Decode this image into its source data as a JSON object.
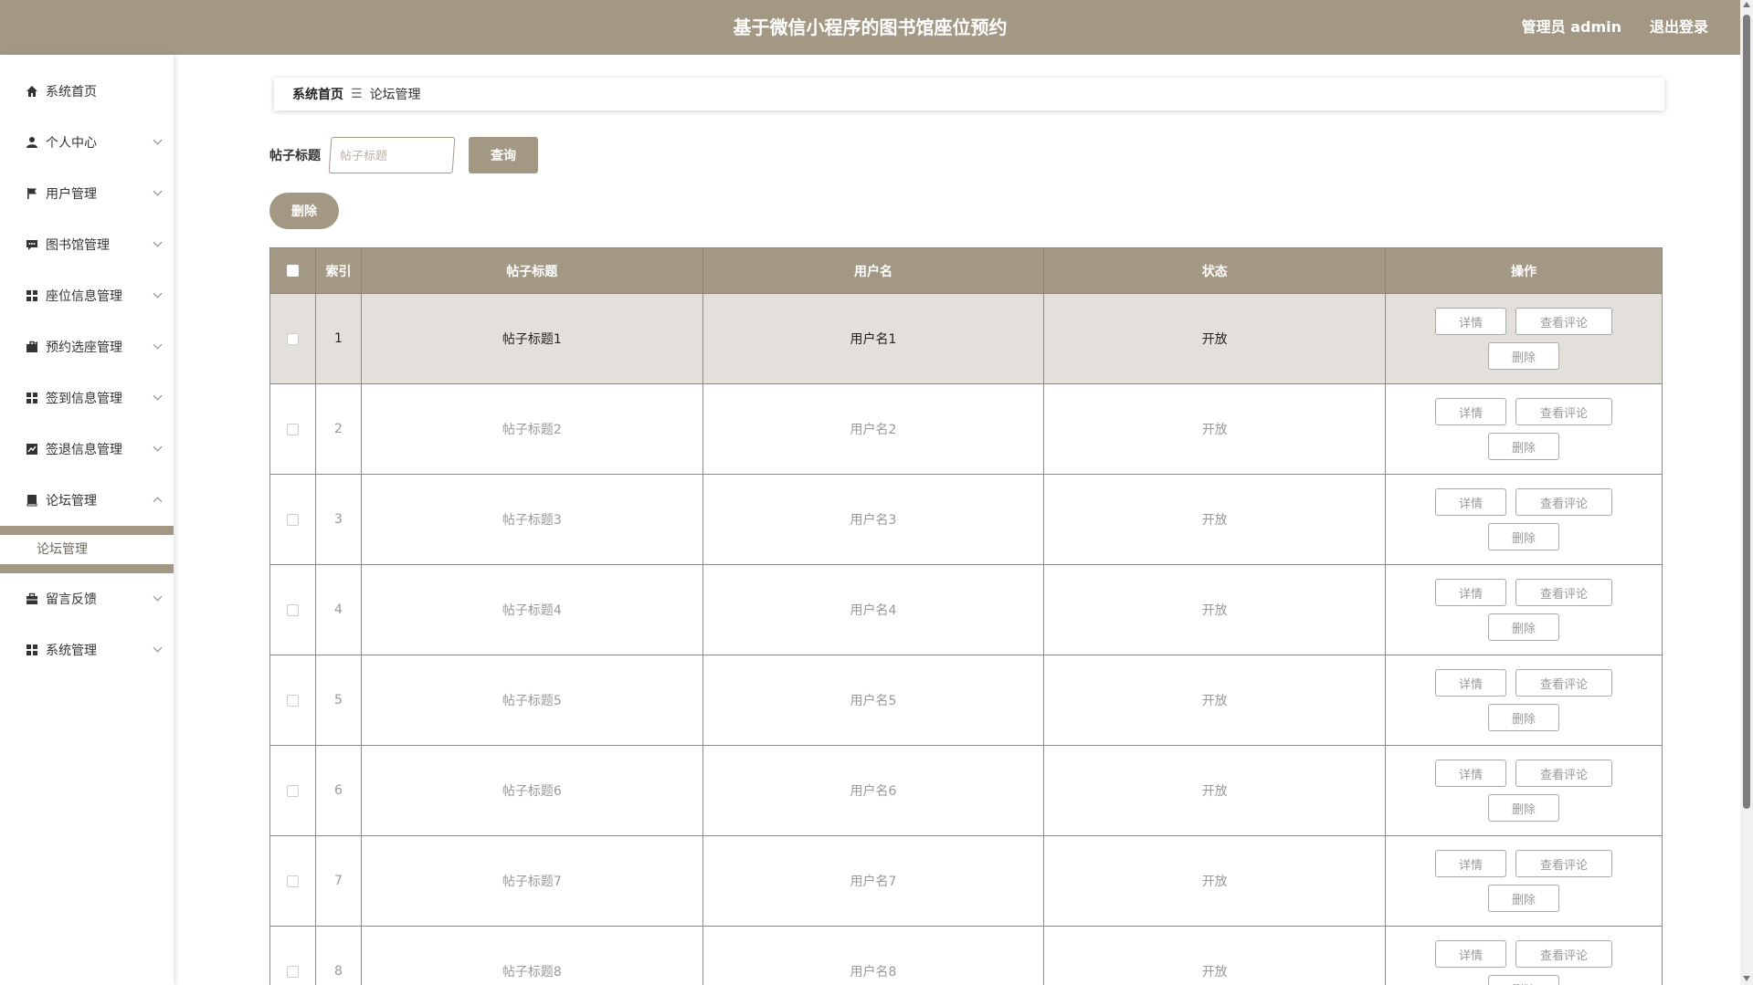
{
  "header": {
    "title": "基于微信小程序的图书馆座位预约",
    "user_label": "管理员 admin",
    "logout_label": "退出登录"
  },
  "sidebar": {
    "items": [
      {
        "label": "系统首页",
        "icon": "home-icon"
      },
      {
        "label": "个人中心",
        "icon": "user-icon"
      },
      {
        "label": "用户管理",
        "icon": "flag-icon"
      },
      {
        "label": "图书馆管理",
        "icon": "comment-icon"
      },
      {
        "label": "座位信息管理",
        "icon": "grid-icon"
      },
      {
        "label": "预约选座管理",
        "icon": "briefcase-icon"
      },
      {
        "label": "签到信息管理",
        "icon": "grid-icon"
      },
      {
        "label": "签退信息管理",
        "icon": "chart-icon"
      },
      {
        "label": "论坛管理",
        "icon": "book-icon"
      },
      {
        "label": "留言反馈",
        "icon": "briefcase-icon"
      },
      {
        "label": "系统管理",
        "icon": "grid-icon"
      }
    ],
    "submenu_item": "论坛管理"
  },
  "breadcrumb": {
    "home": "系统首页",
    "separator": "☰",
    "current": "论坛管理"
  },
  "search": {
    "label": "帖子标题",
    "placeholder": "帖子标题",
    "query_button": "查询"
  },
  "delete_button": "删除",
  "table": {
    "headers": [
      "索引",
      "帖子标题",
      "用户名",
      "状态",
      "操作"
    ],
    "rows": [
      {
        "index": "1",
        "title": "帖子标题1",
        "username": "用户名1",
        "status": "开放"
      },
      {
        "index": "2",
        "title": "帖子标题2",
        "username": "用户名2",
        "status": "开放"
      },
      {
        "index": "3",
        "title": "帖子标题3",
        "username": "用户名3",
        "status": "开放"
      },
      {
        "index": "4",
        "title": "帖子标题4",
        "username": "用户名4",
        "status": "开放"
      },
      {
        "index": "5",
        "title": "帖子标题5",
        "username": "用户名5",
        "status": "开放"
      },
      {
        "index": "6",
        "title": "帖子标题6",
        "username": "用户名6",
        "status": "开放"
      },
      {
        "index": "7",
        "title": "帖子标题7",
        "username": "用户名7",
        "status": "开放"
      },
      {
        "index": "8",
        "title": "帖子标题8",
        "username": "用户名8",
        "status": "开放"
      }
    ],
    "actions": {
      "detail": "详情",
      "comments": "查看评论",
      "delete": "删除"
    }
  },
  "colors": {
    "accent": "#a39884",
    "highlight_row": "#e3e0db"
  }
}
